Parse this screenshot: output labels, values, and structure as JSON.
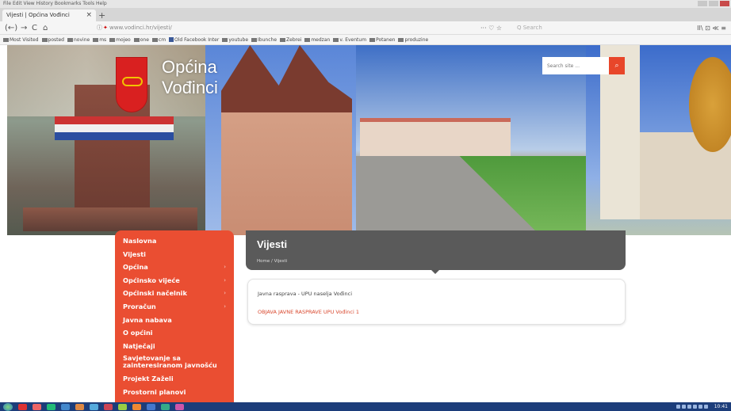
{
  "browser": {
    "menu": "File  Edit  View  History  Bookmarks  Tools  Help",
    "tab_title": "Vijesti | Općina Vođinci",
    "tab_close": "×",
    "new_tab": "+",
    "url": "www.vodinci.hr/vijesti/",
    "page_actions": "··· ♡ ☆",
    "search_placeholder": "Q Search",
    "tools": "II\\ ⊡ ≪ ≡",
    "bookmarks": [
      "Most Visited",
      "posted",
      "novine",
      "ms",
      "mojeo",
      "one",
      "cm",
      "Old Facebook Inter",
      "youtube",
      "Ibunche",
      "Zebrei",
      "medzan",
      "v. Eventum",
      "Potanen",
      "produzine"
    ]
  },
  "site": {
    "logo_line1": "Općina",
    "logo_line2": "Vođinci",
    "search_placeholder": "Search site ...",
    "search_icon": "⌕",
    "menu": [
      {
        "label": "Naslovna",
        "arrow": false
      },
      {
        "label": "Vijesti",
        "arrow": false
      },
      {
        "label": "Općina",
        "arrow": true
      },
      {
        "label": "Općinsko vijeće",
        "arrow": true
      },
      {
        "label": "Općinski načelnik",
        "arrow": true
      },
      {
        "label": "Proračun",
        "arrow": true
      },
      {
        "label": "Javna nabava",
        "arrow": false
      },
      {
        "label": "O općini",
        "arrow": false
      },
      {
        "label": "Natječaji",
        "arrow": false
      },
      {
        "label": "Savjetovanje sa zainteresiranom javnošću",
        "arrow": false
      },
      {
        "label": "Projekt Zaželi",
        "arrow": false
      },
      {
        "label": "Prostorni planovi",
        "arrow": false
      }
    ],
    "menu_arrow": "›",
    "page_heading": "Vijesti",
    "breadcrumb": "Home / Vijesti",
    "news_title": "Javna rasprava - UPU naselja Vođinci",
    "news_link": "OBJAVA JAVNE RASPRAVE UPU Vođinci 1"
  },
  "taskbar": {
    "clock": "10:41"
  }
}
